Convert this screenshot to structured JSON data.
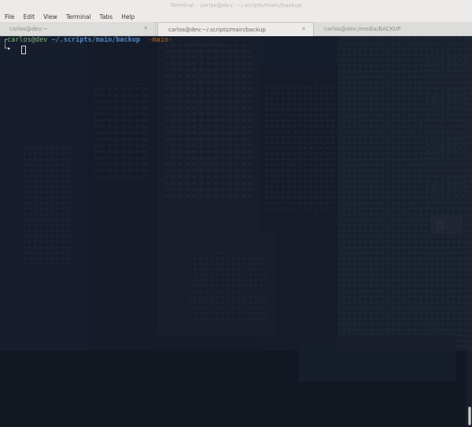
{
  "window": {
    "title": "Terminal - carlos@dev: ~/.scripts/main/backup"
  },
  "menu": {
    "items": [
      "File",
      "Edit",
      "View",
      "Terminal",
      "Tabs",
      "Help"
    ]
  },
  "tabs": [
    {
      "label": "carlos@dev:~",
      "active": false
    },
    {
      "label": "carlos@dev:~/.scripts/main/backup",
      "active": true
    },
    {
      "label": "carlos@dev:/media/BACKUP",
      "active": false
    }
  ],
  "terminal": {
    "corner_glyph": "┌",
    "user_host": "carlos@dev",
    "path": "~/.scripts/main/backup",
    "branch": "-main-",
    "second_line_glyph": "└▸"
  },
  "colors": {
    "terminal_bg": "#171d2a",
    "user_green": "#7fb87a",
    "path_blue": "#4d86c4",
    "branch_orange": "#b36a1f",
    "window_chrome": "#ecebe9"
  }
}
